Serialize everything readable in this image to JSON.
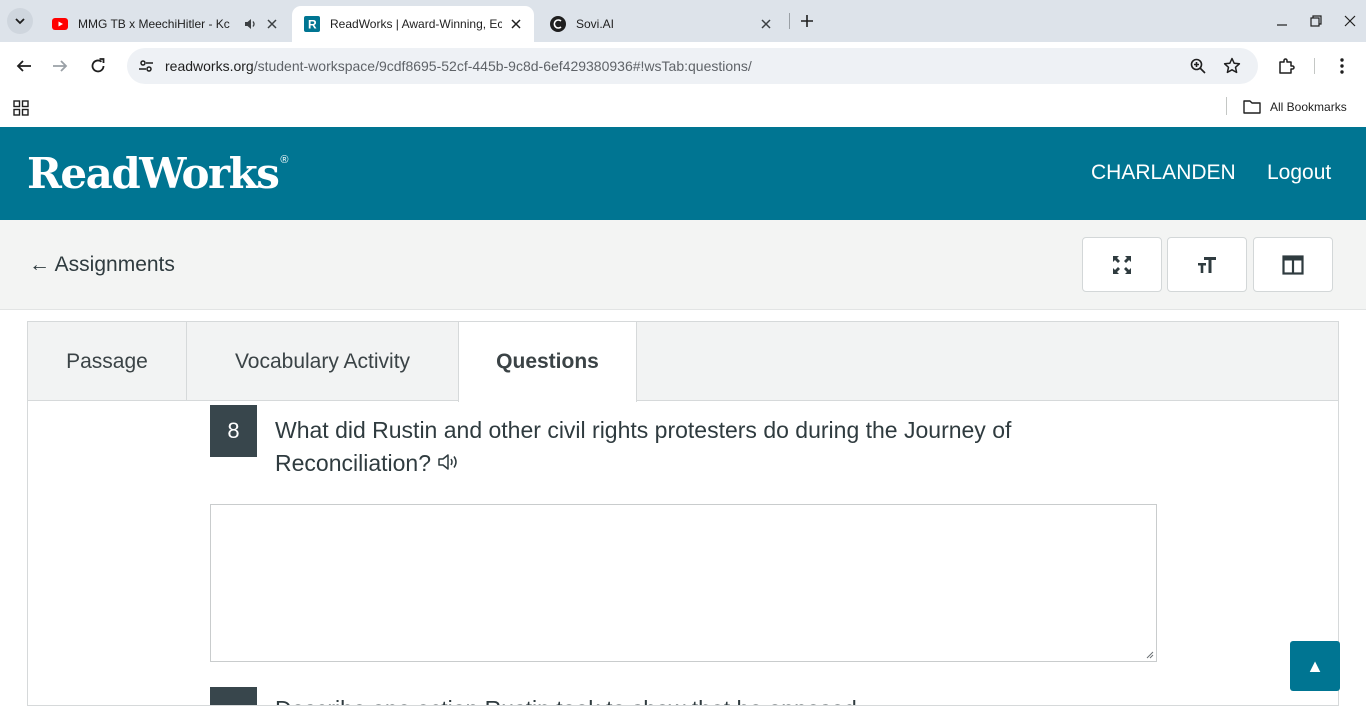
{
  "browser": {
    "tabs": [
      {
        "title": "MMG TB x MeechiHitler - Kc",
        "favicon": "youtube-icon",
        "audio": true
      },
      {
        "title": "ReadWorks | Award-Winning, Ec",
        "favicon": "readworks-icon",
        "active": true
      },
      {
        "title": "Sovi.AI",
        "favicon": "sovi-icon"
      }
    ],
    "url": {
      "host": "readworks.org",
      "path": "/student-workspace/9cdf8695-52cf-445b-9c8d-6ef429380936#!wsTab:questions/"
    },
    "bookmarks": {
      "all_label": "All Bookmarks"
    }
  },
  "header": {
    "logo": "ReadWorks",
    "logo_mark": "®",
    "username": "CHARLANDEN",
    "logout_label": "Logout"
  },
  "subbar": {
    "back_label": "← Assignments",
    "tools": [
      "expand-icon",
      "text-size-icon",
      "split-view-icon"
    ]
  },
  "tabs": [
    {
      "label": "Passage"
    },
    {
      "label": "Vocabulary Activity"
    },
    {
      "label": "Questions",
      "active": true
    }
  ],
  "question": {
    "number": "8",
    "text": "What did Rustin and other civil rights protesters do during the Journey of Reconciliation?",
    "answer": ""
  },
  "next_question": {
    "text": "Describe one action Rustin took to show that he opposed"
  },
  "scroll_top": {
    "label": "▲"
  },
  "colors": {
    "brand": "#007592",
    "question_badge": "#38464c",
    "tabstrip": "#dde3ea"
  }
}
